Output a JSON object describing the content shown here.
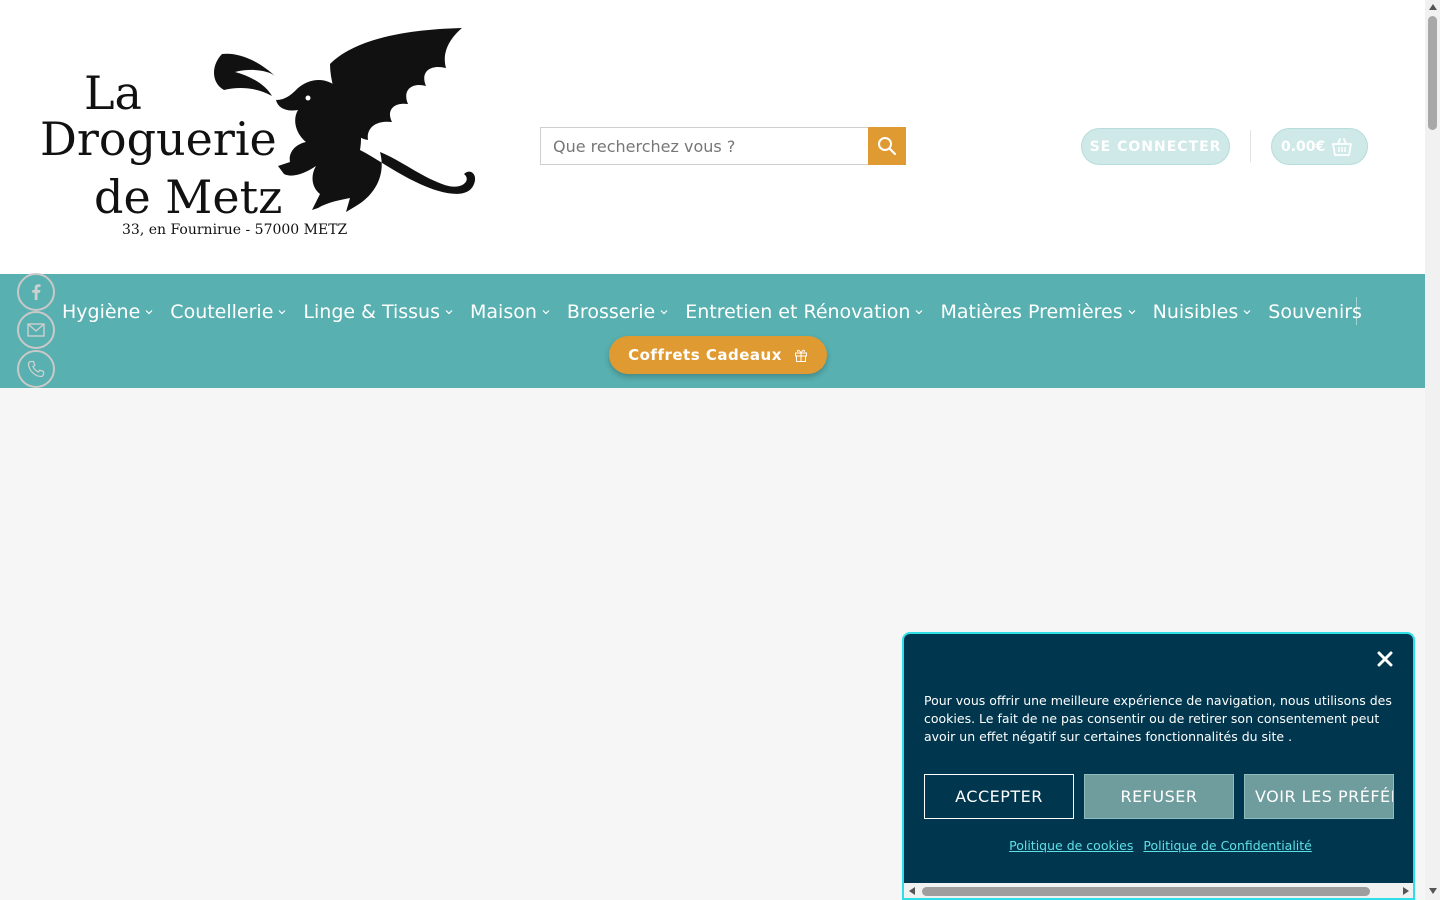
{
  "header": {
    "logo": {
      "line1": "La",
      "line2": "Droguerie",
      "line3": "de Metz",
      "address": "33, en Fournirue - 57000 METZ",
      "mascot_icon": "dragon-icon"
    },
    "search": {
      "placeholder": "Que recherchez vous ?",
      "button_icon": "search-icon"
    },
    "login_label": "SE CONNECTER",
    "cart_total": "0.00€",
    "cart_icon": "basket-icon"
  },
  "nav": {
    "items": [
      {
        "label": "Hygiène",
        "has_dropdown": true
      },
      {
        "label": "Coutellerie",
        "has_dropdown": true
      },
      {
        "label": "Linge & Tissus",
        "has_dropdown": true
      },
      {
        "label": "Maison",
        "has_dropdown": true
      },
      {
        "label": "Brosserie",
        "has_dropdown": true
      },
      {
        "label": "Entretien et Rénovation",
        "has_dropdown": true
      },
      {
        "label": "Matières Premières",
        "has_dropdown": true
      },
      {
        "label": "Nuisibles",
        "has_dropdown": true
      },
      {
        "label": "Souvenirs",
        "has_dropdown": false
      }
    ],
    "gift_button": {
      "label": "Coffrets Cadeaux",
      "icon": "gift-icon"
    }
  },
  "social": [
    {
      "icon": "facebook-icon"
    },
    {
      "icon": "mail-icon"
    },
    {
      "icon": "phone-icon"
    }
  ],
  "cookie_banner": {
    "text": "Pour vous offrir une meilleure expérience de navigation, nous utilisons des cookies. Le fait de ne pas consentir ou de retirer son consentement peut avoir un effet négatif sur certaines fonctionnalités du site .",
    "accept_label": "ACCEPTER",
    "refuse_label": "REFUSER",
    "prefs_label": "VOIR LES PRÉFÉRENCES",
    "cookie_policy_link": "Politique de cookies",
    "privacy_policy_link": "Politique de Confidentialité",
    "close_icon": "close-icon"
  },
  "colors": {
    "nav_bg": "#58b0b0",
    "accent": "#e09a32",
    "login_bg": "#cfe8e8",
    "cookie_bg": "#00374e",
    "cookie_border": "#2ee0e6",
    "page_bg": "#f6f6f6"
  }
}
